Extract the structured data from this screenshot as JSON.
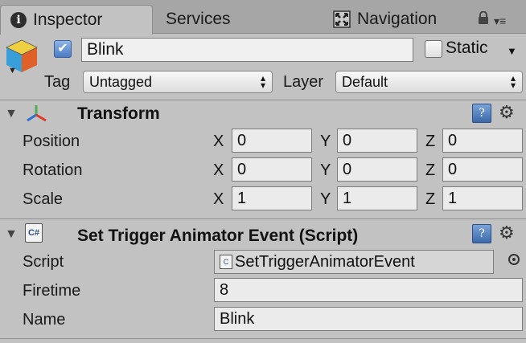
{
  "tabs": [
    {
      "label": "Inspector",
      "icon": "info-icon",
      "active": true
    },
    {
      "label": "Services",
      "active": false
    },
    {
      "label": "Navigation",
      "icon": "navigation-icon",
      "active": false
    }
  ],
  "gameobject": {
    "icon": "gameobject-cube-icon",
    "active": true,
    "name": "Blink",
    "static_label": "Static",
    "static_checked": false,
    "tag_label": "Tag",
    "tag_value": "Untagged",
    "layer_label": "Layer",
    "layer_value": "Default"
  },
  "transform": {
    "title": "Transform",
    "rows": [
      {
        "label": "Position",
        "x": "0",
        "y": "0",
        "z": "0"
      },
      {
        "label": "Rotation",
        "x": "0",
        "y": "0",
        "z": "0"
      },
      {
        "label": "Scale",
        "x": "1",
        "y": "1",
        "z": "1"
      }
    ],
    "axes": {
      "x": "X",
      "y": "Y",
      "z": "Z"
    }
  },
  "script_component": {
    "title": "Set Trigger Animator Event (Script)",
    "script_label": "Script",
    "script_value": "SetTriggerAnimatorEvent",
    "firetime_label": "Firetime",
    "firetime_value": "8",
    "name_label": "Name",
    "name_value": "Blink"
  },
  "colors": {
    "background": "#c2c2c2",
    "tabbar": "#a6a6a6",
    "accent_blue": "#4b7cc2"
  }
}
